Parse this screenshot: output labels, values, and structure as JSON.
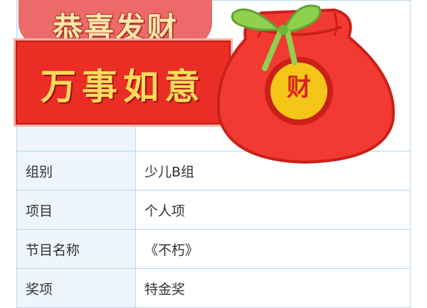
{
  "sticker": {
    "top_text": "恭喜发财",
    "main_text": "万事如意",
    "bag_char": "财"
  },
  "table": {
    "rows": [
      {
        "label": "组别",
        "value": "少儿B组"
      },
      {
        "label": "项目",
        "value": "个人项"
      },
      {
        "label": "节目名称",
        "value": "《不朽》"
      },
      {
        "label": "奖项",
        "value": "特金奖"
      }
    ]
  },
  "colors": {
    "table_border": "#b9d6ec",
    "label_bg": "#eef5fc",
    "banner_red": "#ea2e25",
    "banner_gold": "#f9dc5c",
    "bag_red": "#f23a32",
    "ribbon_green": "#8fd14f"
  }
}
